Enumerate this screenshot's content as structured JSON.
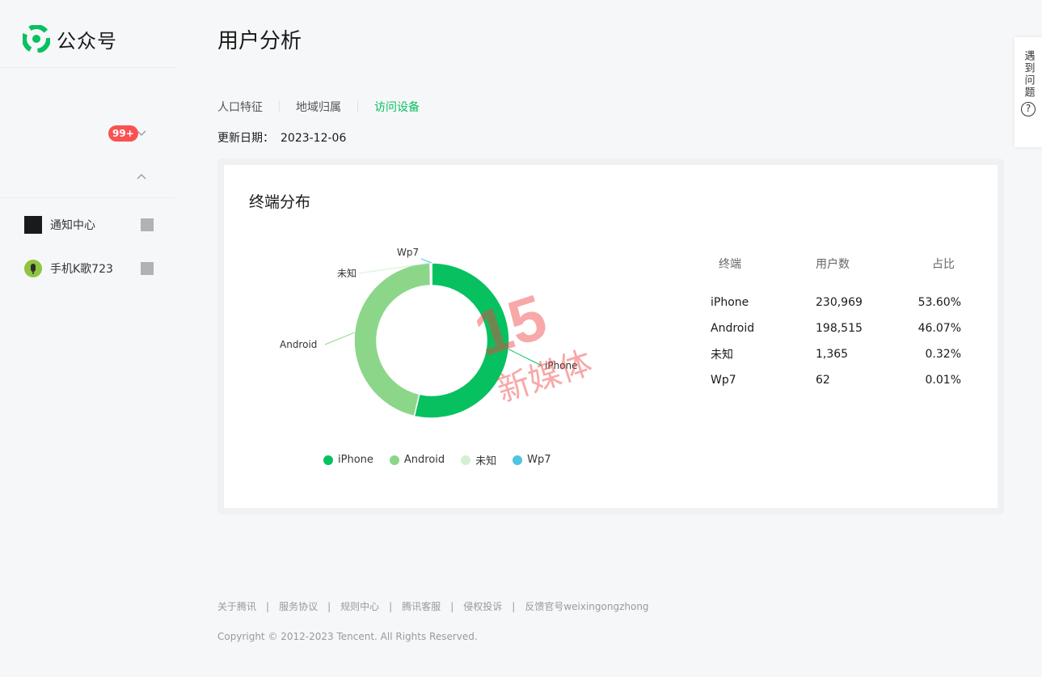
{
  "brand": {
    "name": "公众号",
    "color": "#07c160"
  },
  "sidebar": {
    "badge": "99+",
    "accounts": [
      {
        "name": "通知中心",
        "avatar": "black-square-avatar"
      },
      {
        "name": "手机K歌723",
        "avatar": "microphone-avatar"
      }
    ]
  },
  "page": {
    "title": "用户分析",
    "tabs": [
      {
        "label": "人口特征",
        "active": false
      },
      {
        "label": "地域归属",
        "active": false
      },
      {
        "label": "访问设备",
        "active": true
      }
    ],
    "update_label": "更新日期：",
    "update_date": "2023-12-06"
  },
  "card": {
    "title": "终端分布",
    "table": {
      "headers": [
        "终端",
        "用户数",
        "占比"
      ],
      "rows": [
        [
          "iPhone",
          "230,969",
          "53.60%"
        ],
        [
          "Android",
          "198,515",
          "46.07%"
        ],
        [
          "未知",
          "1,365",
          "0.32%"
        ],
        [
          "Wp7",
          "62",
          "0.01%"
        ]
      ]
    }
  },
  "chart_data": {
    "type": "pie",
    "donut": true,
    "categories": [
      "iPhone",
      "Android",
      "未知",
      "Wp7"
    ],
    "values": [
      230969,
      198515,
      1365,
      62
    ],
    "colors": [
      "#07c160",
      "#8cd68a",
      "#d4efd3",
      "#4ec5e0"
    ],
    "legend": "bottom"
  },
  "watermark": {
    "text": "新媒体",
    "number": "15"
  },
  "help": {
    "label": "遇到问题",
    "icon": "question-icon"
  },
  "footer": {
    "links": [
      "关于腾讯",
      "服务协议",
      "规则中心",
      "腾讯客服",
      "侵权投诉",
      "反馈官号weixingongzhong"
    ],
    "copyright": "Copyright © 2012-2023 Tencent. All Rights Reserved."
  }
}
